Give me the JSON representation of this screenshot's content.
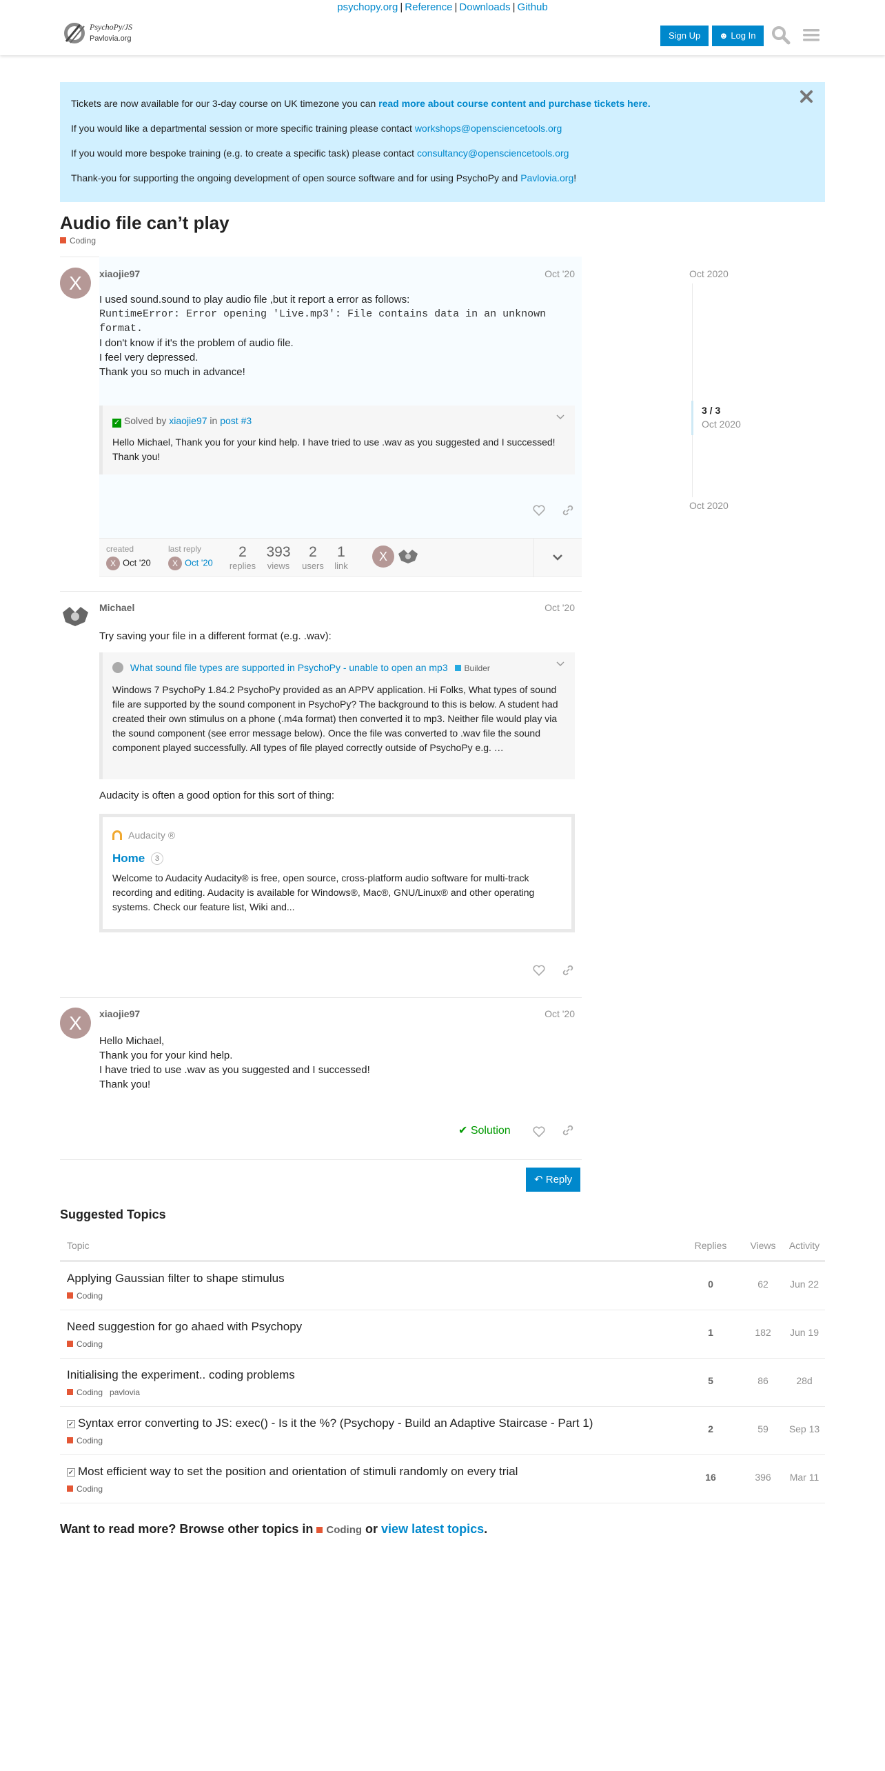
{
  "header": {
    "links": [
      "psychopy.org",
      "Reference",
      "Downloads",
      "Github"
    ],
    "logo_line1": "PsychoPy/JS",
    "logo_line2": "Pavlovia.org",
    "signup": "Sign Up",
    "login": "Log In"
  },
  "banner": {
    "line1_pre": "Tickets are now available for our 3-day course on UK timezone you can ",
    "line1_link": "read more about course content and purchase tickets here.",
    "line2_pre": "If you would like a departmental session or more specific training please contact ",
    "line2_link": "workshops@opensciencetools.org",
    "line3_pre": "If you would more bespoke training (e.g. to create a specific task) please contact ",
    "line3_link": "consultancy@opensciencetools.org",
    "line4_pre": "Thank-you for supporting the ongoing development of open source software and for using PsychoPy and ",
    "line4_link": "Pavlovia.org",
    "line4_post": "!"
  },
  "topic": {
    "title": "Audio file can’t play",
    "category": "Coding"
  },
  "posts": [
    {
      "username": "xiaojie97",
      "avatar_letter": "X",
      "date": "Oct '20",
      "lines": [
        "I used sound.sound to play audio file ,but it report a error as follows:",
        "RuntimeError: Error opening 'Live.mp3': File contains data in an unknown",
        "format.",
        "I don't know if it's the problem of audio file.",
        "I feel very depressed.",
        "Thank you so much in advance!"
      ],
      "solved_prefix": "Solved by",
      "solved_user": "xiaojie97",
      "solved_in": "in",
      "solved_post": "post #3",
      "solved_text": "Hello Michael, Thank you for your kind help. I have tried to use .wav as you suggested and I successed! Thank you!"
    },
    {
      "username": "Michael",
      "date": "Oct '20",
      "intro": "Try saving your file in a different format (e.g. .wav):",
      "quote_title": "What sound file types are supported in PsychoPy - unable to open an mp3",
      "quote_category": "Builder",
      "quote_text": "Windows 7 PsychoPy 1.84.2 PsychoPy provided as an APPV application. Hi Folks, What types of sound file are supported by the sound component in PsychoPy? The background to this is below. A student had created their own stimulus on a phone (.m4a format) then converted it to mp3. Neither file would play via the sound component (see error message below). Once the file was converted to .wav file the sound component played successfully. All types of file played correctly outside of PsychoPy e.g. …",
      "audacity_text": "Audacity is often a good option for this sort of thing:",
      "onebox_site": "Audacity ®",
      "onebox_title": "Home",
      "onebox_count": "3",
      "onebox_desc": "Welcome to Audacity Audacity® is free, open source, cross-platform audio software for multi-track recording and editing. Audacity is available for Windows®, Mac®, GNU/Linux® and other operating systems. Check our feature list, Wiki and..."
    },
    {
      "username": "xiaojie97",
      "avatar_letter": "X",
      "date": "Oct '20",
      "lines": [
        "Hello Michael,",
        "Thank you for your kind help.",
        "I have tried to use .wav as you suggested and I successed!",
        "Thank you!"
      ],
      "solution_label": "Solution"
    }
  ],
  "topic_map": {
    "created_label": "created",
    "created_date": "Oct '20",
    "last_reply_label": "last reply",
    "last_reply_date": "Oct '20",
    "replies": "2",
    "replies_label": "replies",
    "views": "393",
    "views_label": "views",
    "users": "2",
    "users_label": "users",
    "links": "1",
    "links_label": "link"
  },
  "timeline": {
    "top_date": "Oct 2020",
    "position": "3 / 3",
    "position_date": "Oct 2020",
    "bottom_date": "Oct 2020"
  },
  "reply_button": "Reply",
  "suggested": {
    "heading": "Suggested Topics",
    "columns": [
      "Topic",
      "Replies",
      "Views",
      "Activity"
    ],
    "rows": [
      {
        "title": "Applying Gaussian filter to shape stimulus",
        "category": "Coding",
        "tag": "",
        "replies": "0",
        "views": "62",
        "activity": "Jun 22",
        "solved": false
      },
      {
        "title": "Need suggestion for go ahaed with Psychopy",
        "category": "Coding",
        "tag": "",
        "replies": "1",
        "views": "182",
        "activity": "Jun 19",
        "solved": false
      },
      {
        "title": "Initialising the experiment.. coding problems",
        "category": "Coding",
        "tag": "pavlovia",
        "replies": "5",
        "views": "86",
        "activity": "28d",
        "solved": false
      },
      {
        "title": "Syntax error converting to JS: exec() - Is it the %? (Psychopy - Build an Adaptive Staircase - Part 1)",
        "category": "Coding",
        "tag": "",
        "replies": "2",
        "views": "59",
        "activity": "Sep 13",
        "solved": true
      },
      {
        "title": "Most efficient way to set the position and orientation of stimuli randomly on every trial",
        "category": "Coding",
        "tag": "",
        "replies": "16",
        "views": "396",
        "activity": "Mar 11",
        "solved": true
      }
    ]
  },
  "footer": {
    "pre": "Want to read more? Browse other topics in ",
    "category": "Coding",
    "mid": " or ",
    "link": "view latest topics",
    "post": "."
  },
  "colors": {
    "accent": "#0088cc",
    "banner_bg": "#d1f0ff",
    "category_coding": "#e45735",
    "category_builder": "#25aae1",
    "solution_green": "#009900"
  }
}
